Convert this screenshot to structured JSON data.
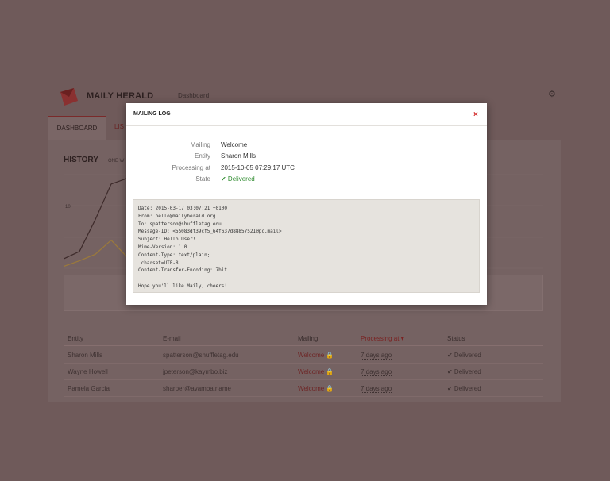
{
  "app": {
    "brand": "MAILY HERALD",
    "nav_dashboard": "Dashboard"
  },
  "tabs": [
    {
      "label": "DASHBOARD"
    },
    {
      "label": "LIS"
    }
  ],
  "history": {
    "title": "HISTORY",
    "subtitle": "ONE W"
  },
  "chart_data": {
    "type": "line",
    "ytick_labels": [
      "10"
    ],
    "series": [
      {
        "color": "#3d2a2a",
        "values": [
          0.1,
          0.18,
          0.52,
          0.9,
          0.96,
          0.96,
          0.96,
          0.62,
          0.3,
          0.1,
          0.02
        ]
      },
      {
        "color": "#9c7a3a",
        "values": [
          0.02,
          0.08,
          0.15,
          0.3,
          0.12,
          0.04,
          0.02
        ]
      }
    ]
  },
  "table": {
    "headers": [
      "Entity",
      "E-mail",
      "Mailing",
      "Processing at ▾",
      "Status"
    ],
    "rows": [
      {
        "entity": "Sharon Mills",
        "email": "spatterson@shuffletag.edu",
        "mailing": "Welcome 🔒",
        "processing": "7 days ago",
        "status": "✔ Delivered"
      },
      {
        "entity": "Wayne Howell",
        "email": "jpeterson@kaymbo.biz",
        "mailing": "Welcome 🔒",
        "processing": "7 days ago",
        "status": "✔ Delivered"
      },
      {
        "entity": "Pamela Garcia",
        "email": "sharper@avamba.name",
        "mailing": "Welcome 🔒",
        "processing": "7 days ago",
        "status": "✔ Delivered"
      }
    ]
  },
  "modal": {
    "title": "MAILING LOG",
    "close": "×",
    "fields": [
      {
        "label": "Mailing",
        "value": "Welcome"
      },
      {
        "label": "Entity",
        "value": "Sharon Mills"
      },
      {
        "label": "Processing at",
        "value": "2015-10-05 07:29:17 UTC"
      },
      {
        "label": "State",
        "value": "✔ Delivered"
      }
    ],
    "raw": "Date: 2015-03-17 03:07:21 +0100\nFrom: hello@mailyherald.org\nTo: spatterson@shuffletag.edu\nMessage-ID: <55083df39cf5_64f637d8885752I@pc.mail>\nSubject: Hello User!\nMime-Version: 1.0\nContent-Type: text/plain;\n charset=UTF-8\nContent-Transfer-Encoding: 7bit\n\nHope you'll like Maily, cheers!"
  }
}
